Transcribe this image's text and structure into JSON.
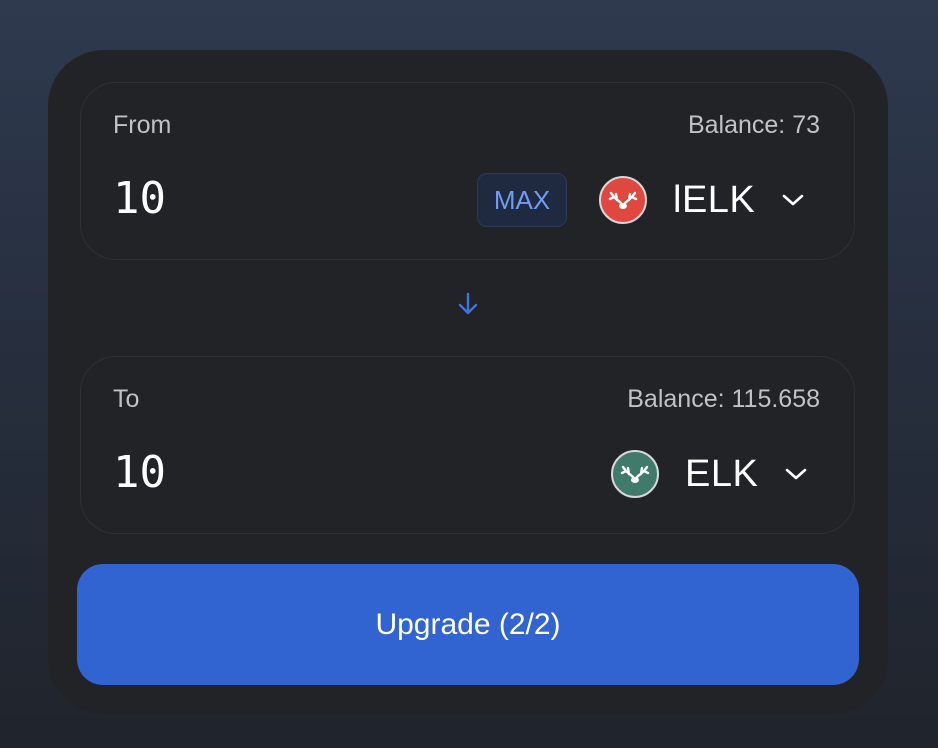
{
  "from": {
    "label": "From",
    "balance": "Balance: 73",
    "amount": "10",
    "max_label": "MAX",
    "token": {
      "name": "lELK",
      "icon": "elk-antlers-icon",
      "icon_color": "#e0483f"
    }
  },
  "to": {
    "label": "To",
    "balance": "Balance: 115.658",
    "amount": "10",
    "token": {
      "name": "ELK",
      "icon": "elk-antlers-icon",
      "icon_color": "#3f7a6b"
    }
  },
  "swap_direction_icon": "arrow-down-icon",
  "accent_color": "#3264d1",
  "upgrade_button_label": "Upgrade (2/2)"
}
